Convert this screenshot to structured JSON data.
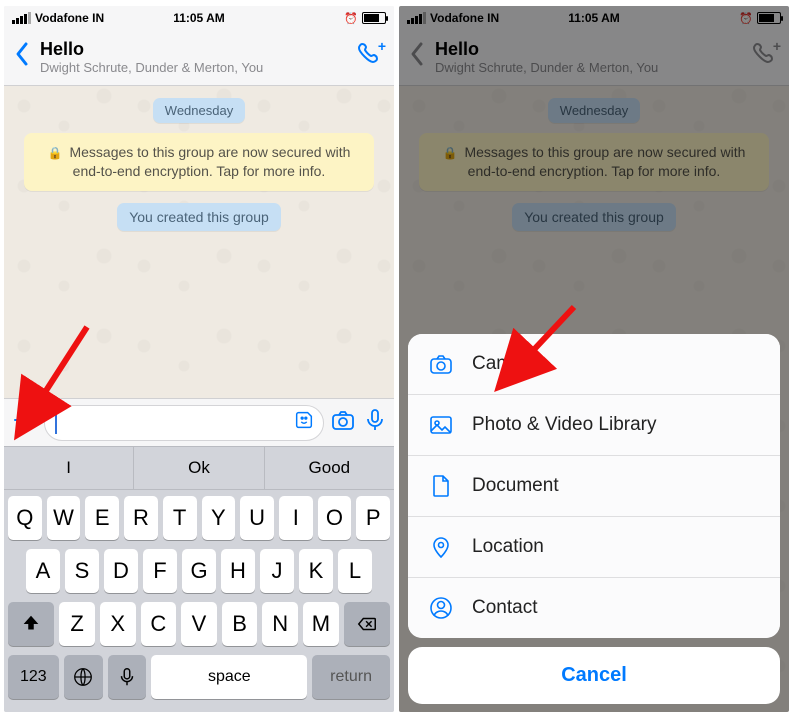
{
  "status": {
    "carrier": "Vodafone IN",
    "time": "11:05 AM"
  },
  "header": {
    "title": "Hello",
    "subtitle": "Dwight Schrute, Dunder & Merton, You"
  },
  "chat": {
    "day_label": "Wednesday",
    "encryption_notice": "Messages to this group are now secured with end-to-end encryption. Tap for more info.",
    "created_notice": "You created this group"
  },
  "predictions": [
    "I",
    "Ok",
    "Good"
  ],
  "keyboard": {
    "row1": [
      "Q",
      "W",
      "E",
      "R",
      "T",
      "Y",
      "U",
      "I",
      "O",
      "P"
    ],
    "row2": [
      "A",
      "S",
      "D",
      "F",
      "G",
      "H",
      "J",
      "K",
      "L"
    ],
    "row3": [
      "Z",
      "X",
      "C",
      "V",
      "B",
      "N",
      "M"
    ],
    "numkey": "123",
    "space": "space",
    "return": "return"
  },
  "sheet": {
    "items": [
      {
        "label": "Camera"
      },
      {
        "label": "Photo & Video Library"
      },
      {
        "label": "Document"
      },
      {
        "label": "Location"
      },
      {
        "label": "Contact"
      }
    ],
    "cancel": "Cancel"
  }
}
